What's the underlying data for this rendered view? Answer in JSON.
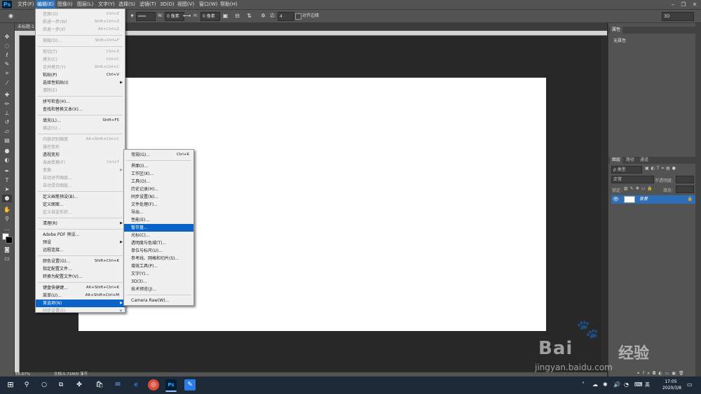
{
  "app": {
    "logo": "Ps"
  },
  "menubar": {
    "items": [
      "文件(F)",
      "编辑(E)",
      "图像(I)",
      "图层(L)",
      "文字(Y)",
      "选择(S)",
      "滤镜(T)",
      "3D(D)",
      "视图(V)",
      "窗口(W)",
      "帮助(H)"
    ],
    "window_buttons": [
      "‒",
      "❐",
      "✕"
    ]
  },
  "options": {
    "w_label": "W:",
    "w_value": "0 像素",
    "h_label": "H:",
    "h_value": "0 像素",
    "edge_label": "边:",
    "edge_value": "4",
    "align_label": "对齐边缘",
    "workspace": "3D"
  },
  "document": {
    "tab": "未标题-1 @ 66.7%(RGB/8)",
    "zoom": "66.67%",
    "doc_info": "文档:5.71M/0 字节"
  },
  "edit_menu": {
    "items": [
      {
        "label": "还原(O)",
        "shortcut": "Ctrl+Z",
        "disabled": true
      },
      {
        "label": "前进一步(W)",
        "shortcut": "Shift+Ctrl+Z",
        "disabled": true
      },
      {
        "label": "后退一步(K)",
        "shortcut": "Alt+Ctrl+Z",
        "disabled": true
      },
      {
        "sep": true
      },
      {
        "label": "渐隐(D)...",
        "shortcut": "Shift+Ctrl+F",
        "disabled": true
      },
      {
        "sep": true
      },
      {
        "label": "剪切(T)",
        "shortcut": "Ctrl+X",
        "disabled": true
      },
      {
        "label": "拷贝(C)",
        "shortcut": "Ctrl+C",
        "disabled": true
      },
      {
        "label": "合并拷贝(Y)",
        "shortcut": "Shift+Ctrl+C",
        "disabled": true
      },
      {
        "label": "粘贴(P)",
        "shortcut": "Ctrl+V"
      },
      {
        "label": "选择性粘贴(I)",
        "shortcut": "",
        "submenu": true
      },
      {
        "label": "清除(E)",
        "shortcut": "",
        "disabled": true
      },
      {
        "sep": true
      },
      {
        "label": "拼写检查(H)...",
        "shortcut": ""
      },
      {
        "label": "查找和替换文本(X)...",
        "shortcut": ""
      },
      {
        "sep": true
      },
      {
        "label": "填充(L)...",
        "shortcut": "Shift+F5"
      },
      {
        "label": "描边(S)...",
        "shortcut": "",
        "disabled": true
      },
      {
        "sep": true
      },
      {
        "label": "内容识别缩放",
        "shortcut": "Alt+Shift+Ctrl+C",
        "disabled": true
      },
      {
        "label": "操控变形",
        "shortcut": "",
        "disabled": true
      },
      {
        "label": "透视变形",
        "shortcut": ""
      },
      {
        "label": "自由变换(F)",
        "shortcut": "Ctrl+T",
        "disabled": true
      },
      {
        "label": "变换",
        "shortcut": "",
        "disabled": true,
        "submenu": true
      },
      {
        "label": "自动对齐图层...",
        "shortcut": "",
        "disabled": true
      },
      {
        "label": "自动混合图层...",
        "shortcut": "",
        "disabled": true
      },
      {
        "sep": true
      },
      {
        "label": "定义画笔预设(B)...",
        "shortcut": ""
      },
      {
        "label": "定义图案...",
        "shortcut": ""
      },
      {
        "label": "定义自定形状...",
        "shortcut": "",
        "disabled": true
      },
      {
        "sep": true
      },
      {
        "label": "清理(R)",
        "shortcut": "",
        "submenu": true
      },
      {
        "sep": true
      },
      {
        "label": "Adobe PDF 预设...",
        "shortcut": ""
      },
      {
        "label": "预设",
        "shortcut": "",
        "submenu": true
      },
      {
        "label": "远程连接...",
        "shortcut": ""
      },
      {
        "sep": true
      },
      {
        "label": "颜色设置(G)...",
        "shortcut": "Shift+Ctrl+K"
      },
      {
        "label": "指定配置文件...",
        "shortcut": ""
      },
      {
        "label": "转换为配置文件(V)...",
        "shortcut": ""
      },
      {
        "sep": true
      },
      {
        "label": "键盘快捷键...",
        "shortcut": "Alt+Shift+Ctrl+K"
      },
      {
        "label": "菜单(U)...",
        "shortcut": "Alt+Shift+Ctrl+M"
      },
      {
        "label": "首选项(N)",
        "shortcut": "",
        "submenu": true,
        "highlighted": true
      },
      {
        "label": "同步设置(E)",
        "shortcut": "",
        "disabled": true,
        "submenu": true
      }
    ]
  },
  "pref_menu": {
    "items": [
      {
        "label": "常规(G)...",
        "shortcut": "Ctrl+K"
      },
      {
        "sep": true
      },
      {
        "label": "界面(I)...",
        "shortcut": ""
      },
      {
        "label": "工作区(K)...",
        "shortcut": ""
      },
      {
        "label": "工具(O)...",
        "shortcut": ""
      },
      {
        "label": "历史记录(H)...",
        "shortcut": ""
      },
      {
        "label": "同步设置(N)...",
        "shortcut": ""
      },
      {
        "label": "文件处理(F)...",
        "shortcut": ""
      },
      {
        "label": "导出...",
        "shortcut": ""
      },
      {
        "label": "性能(E)...",
        "shortcut": ""
      },
      {
        "label": "暂存盘...",
        "shortcut": "",
        "highlighted": true
      },
      {
        "label": "光标(C)...",
        "shortcut": ""
      },
      {
        "label": "透明度与色域(T)...",
        "shortcut": ""
      },
      {
        "label": "单位与标尺(U)...",
        "shortcut": ""
      },
      {
        "label": "参考线、网格和切片(S)...",
        "shortcut": ""
      },
      {
        "label": "增效工具(P)...",
        "shortcut": ""
      },
      {
        "label": "文字(Y)...",
        "shortcut": ""
      },
      {
        "label": "3D(3)...",
        "shortcut": ""
      },
      {
        "label": "技术预览(J)...",
        "shortcut": ""
      },
      {
        "sep": true
      },
      {
        "label": "Camera Raw(W)...",
        "shortcut": ""
      }
    ]
  },
  "properties": {
    "tab": "属性",
    "empty": "无属性"
  },
  "layers": {
    "tabs": [
      "图层",
      "路径",
      "通道"
    ],
    "filter_label": "ρ 类型",
    "blend_mode": "正常",
    "opacity_label": "不透明度:",
    "lock_label": "锁定:",
    "fill_label": "填充:",
    "layer_name": "背景"
  },
  "watermark": {
    "brand": "Bai",
    "brand_cn": "经验",
    "url": "jingyan.baidu.com"
  },
  "taskbar": {
    "time": "17:05",
    "date": "2020/3/8",
    "ime": "英"
  }
}
